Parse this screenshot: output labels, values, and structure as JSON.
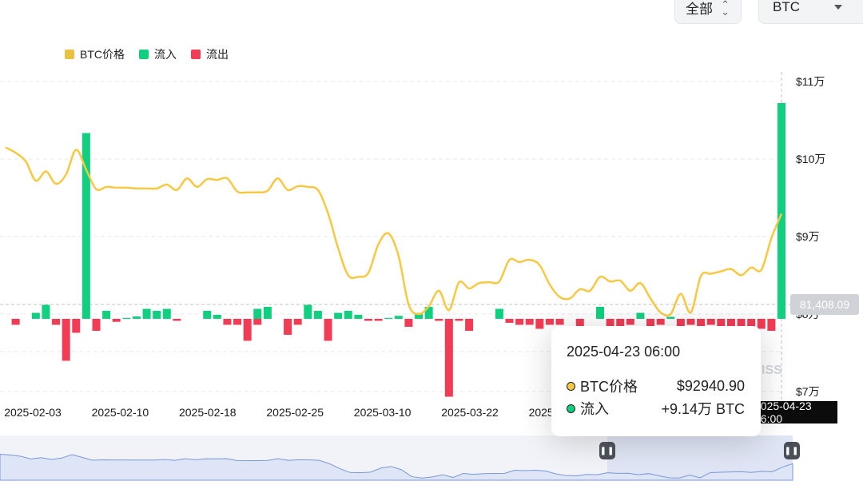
{
  "controls": {
    "range_label": "全部",
    "coin_label": "BTC"
  },
  "colors": {
    "price": "#f7c843",
    "inflow": "#10d07f",
    "outflow": "#f23b55",
    "grid": "#e6e8eb",
    "brush_fill": "#dde5f7",
    "brush_line": "#7a97d8"
  },
  "chart_data": {
    "type": "bar",
    "legend": [
      "BTC价格",
      "流入",
      "流出"
    ],
    "legend_position": "top-left",
    "y_right_ticks": [
      {
        "value": 110000,
        "label": "$11万"
      },
      {
        "value": 100000,
        "label": "$10万"
      },
      {
        "value": 90000,
        "label": "$9万"
      },
      {
        "value": 80000,
        "label": "$8万"
      },
      {
        "value": 70000,
        "label": "$7万"
      }
    ],
    "price_ylim": [
      70000,
      110000
    ],
    "flow_ylim": [
      -4.5,
      10.5
    ],
    "x_tick_labels": [
      "2025-02-03",
      "2025-02-10",
      "2025-02-18",
      "2025-02-25",
      "2025-03-10",
      "2025-03-22",
      "2025-04-01"
    ],
    "grid": true,
    "series": [
      {
        "name": "BTC价格",
        "type": "line",
        "values": [
          101500,
          100800,
          99700,
          97200,
          98400,
          96800,
          98000,
          101200,
          98600,
          96100,
          96400,
          96300,
          96300,
          96200,
          96200,
          96200,
          96700,
          96000,
          97500,
          96400,
          97400,
          97300,
          97500,
          95800,
          95700,
          95700,
          95900,
          97500,
          96000,
          96500,
          96400,
          96000,
          93000,
          88500,
          85000,
          84800,
          85300,
          89000,
          90400,
          87500,
          81200,
          80000,
          81000,
          83000,
          80500,
          84100,
          83300,
          84000,
          84100,
          84200,
          87000,
          86700,
          87000,
          86300,
          83800,
          82200,
          82000,
          83200,
          83000,
          84800,
          84200,
          84300,
          83000,
          84000,
          82000,
          80200,
          80000,
          82600,
          80200,
          84900,
          85200,
          85500,
          85800,
          85000,
          86000,
          85700,
          89800,
          92940
        ]
      },
      {
        "name": "流入",
        "type": "bar",
        "values": [
          0,
          0,
          0,
          0.3,
          0.7,
          0,
          0,
          0,
          9.3,
          0,
          0.4,
          0,
          0.05,
          0.12,
          0.5,
          0.4,
          0.5,
          0,
          0,
          0,
          0.4,
          0.2,
          0,
          0,
          0,
          0.5,
          0.6,
          0,
          0,
          0,
          0.7,
          0.4,
          0,
          0.3,
          0.4,
          0.2,
          0,
          0,
          0.05,
          0.15,
          0,
          0.3,
          0.6,
          0,
          0,
          0,
          0,
          0,
          0,
          0.5,
          0,
          0,
          0,
          0,
          0,
          0,
          0,
          0,
          0,
          0.6,
          0,
          0,
          0,
          0.3,
          0,
          0,
          0.1,
          0,
          0,
          0,
          0,
          0,
          0,
          0,
          0,
          0,
          0,
          10.8
        ]
      },
      {
        "name": "流出",
        "type": "bar",
        "values": [
          0,
          -0.3,
          0,
          0,
          0,
          -0.3,
          -2.1,
          -0.7,
          0,
          -0.6,
          0,
          -0.15,
          0,
          0,
          0,
          0,
          0,
          -0.1,
          0,
          0,
          0,
          0,
          -0.3,
          -0.3,
          -1.1,
          -0.3,
          0,
          0,
          -0.8,
          -0.3,
          0,
          0,
          -1.1,
          0,
          0,
          0,
          -0.1,
          -0.1,
          0,
          0,
          -0.4,
          0,
          0,
          -0.1,
          -3.9,
          -0.1,
          -0.6,
          0,
          0,
          0,
          -0.2,
          -0.3,
          -0.3,
          -0.5,
          -0.3,
          -0.3,
          0,
          -0.4,
          0,
          0,
          -0.4,
          -0.8,
          -0.3,
          0,
          -0.4,
          -0.3,
          0,
          -0.4,
          -0.3,
          -0.5,
          -0.3,
          -0.6,
          -0.4,
          -0.5,
          -0.5,
          -0.5,
          -0.6,
          0
        ]
      }
    ],
    "crosshair": {
      "price_label": "81,408.09",
      "time_label": "2025-04-23 06:00"
    }
  },
  "tooltip": {
    "time": "2025-04-23 06:00",
    "price_label": "BTC价格",
    "price_value": "$92940.90",
    "inflow_label": "流入",
    "inflow_value": "+9.14万 BTC"
  },
  "watermark": "ISS"
}
